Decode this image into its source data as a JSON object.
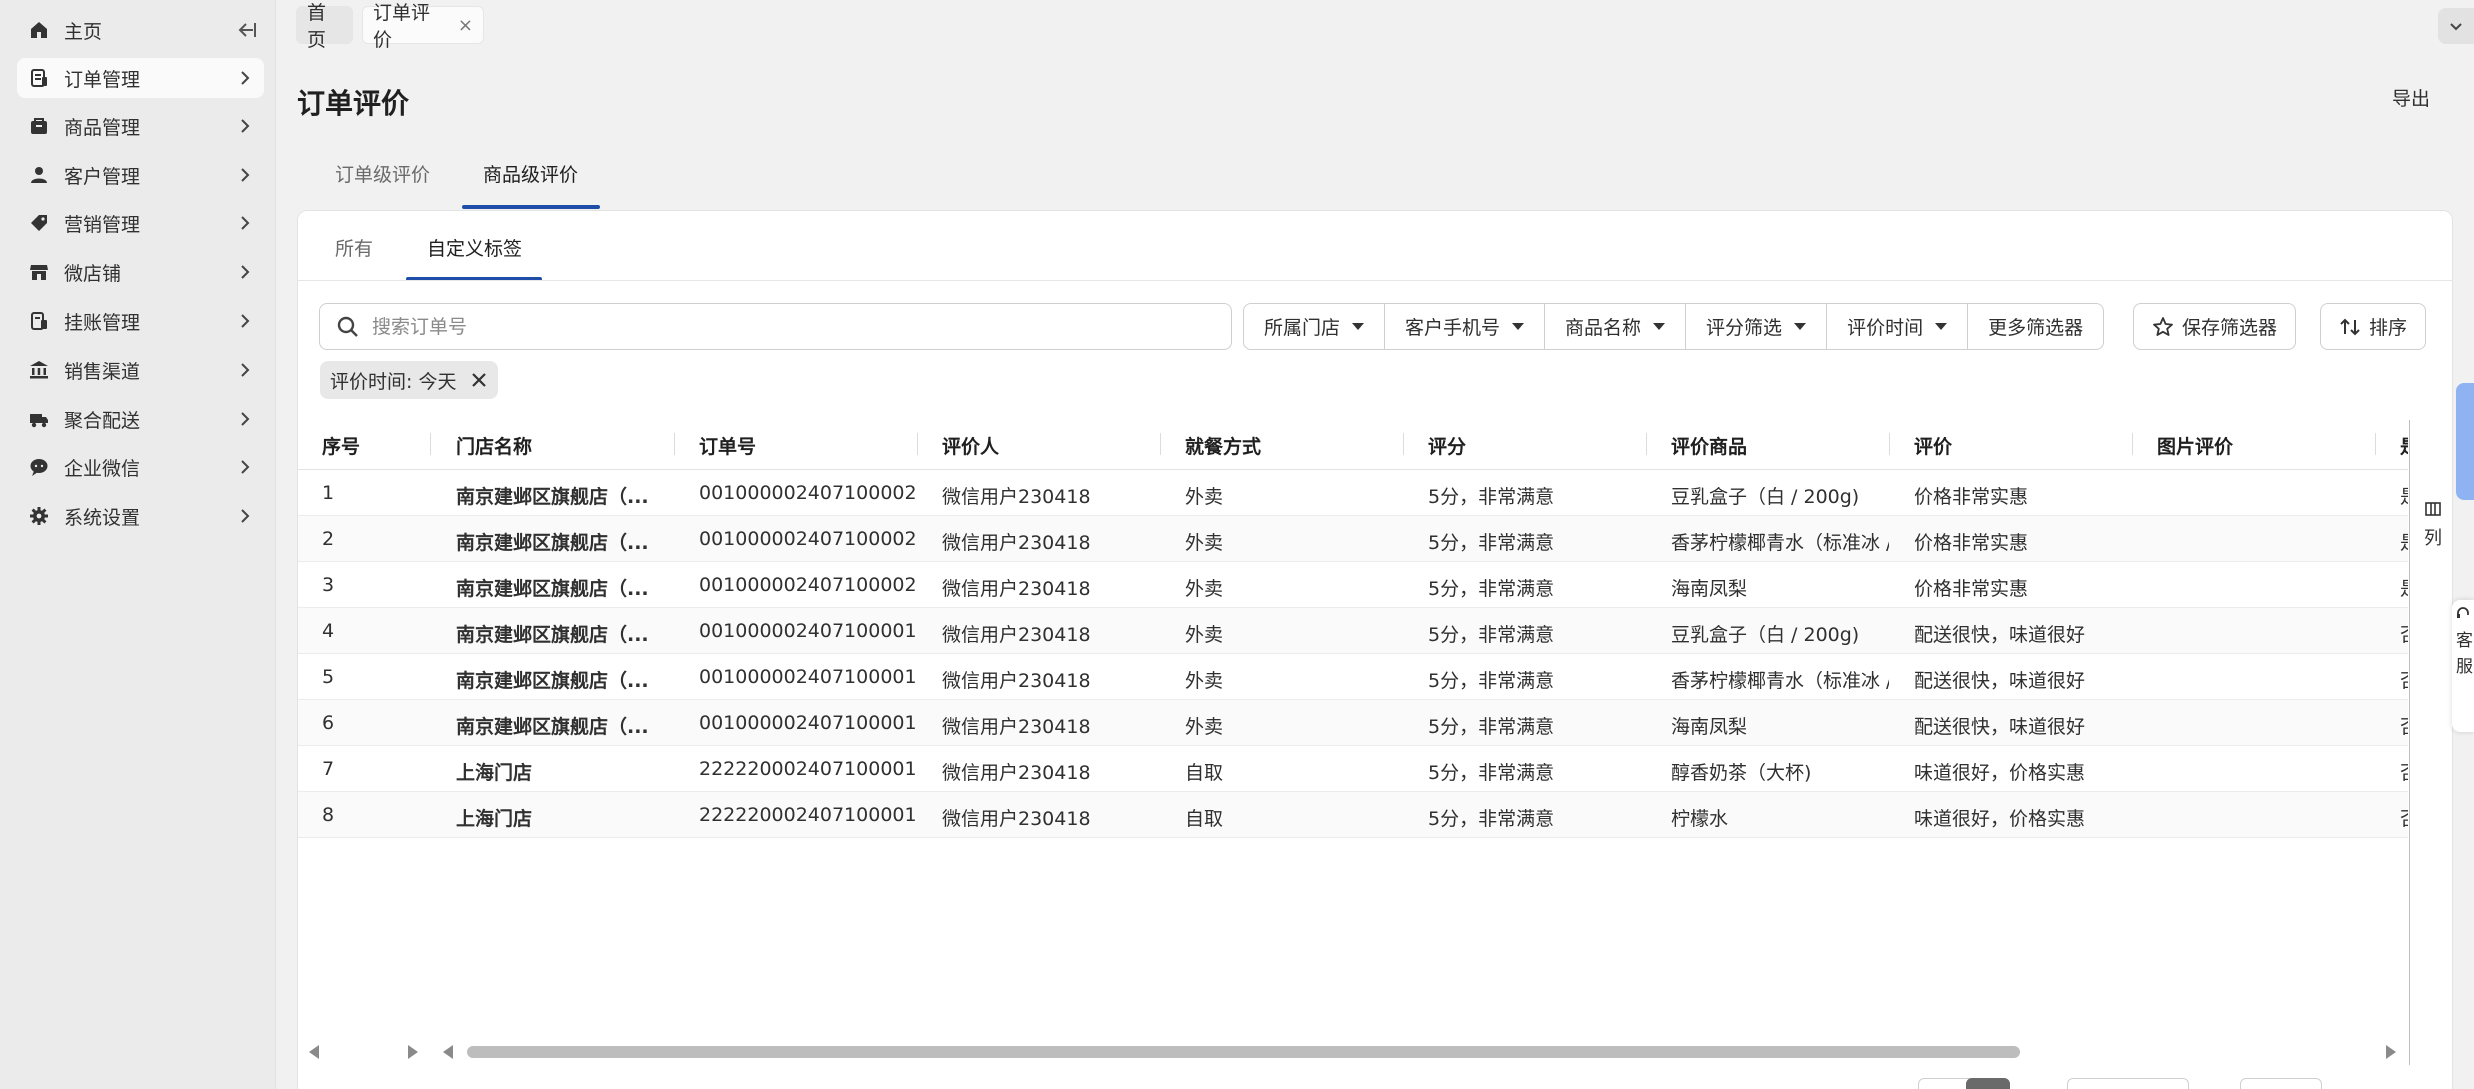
{
  "sidebar": {
    "items": [
      {
        "label": "主页",
        "icon": "home-icon"
      },
      {
        "label": "订单管理",
        "icon": "order-icon"
      },
      {
        "label": "商品管理",
        "icon": "product-icon"
      },
      {
        "label": "客户管理",
        "icon": "person-icon"
      },
      {
        "label": "营销管理",
        "icon": "tag-icon"
      },
      {
        "label": "微店铺",
        "icon": "store-icon"
      },
      {
        "label": "挂账管理",
        "icon": "ledger-icon"
      },
      {
        "label": "销售渠道",
        "icon": "bank-icon"
      },
      {
        "label": "聚合配送",
        "icon": "delivery-icon"
      },
      {
        "label": "企业微信",
        "icon": "wechat-icon"
      },
      {
        "label": "系统设置",
        "icon": "gear-icon"
      }
    ],
    "active_index": 1
  },
  "top_tabs": {
    "home": "首页",
    "current": "订单评价",
    "close_glyph": "×"
  },
  "page": {
    "title": "订单评价",
    "export": "导出"
  },
  "level_tabs": [
    {
      "label": "订单级评价",
      "active": false
    },
    {
      "label": "商品级评价",
      "active": true
    }
  ],
  "sub_tabs": [
    {
      "label": "所有",
      "active": false
    },
    {
      "label": "自定义标签",
      "active": true
    }
  ],
  "filters": {
    "search_placeholder": "搜索订单号",
    "dropdowns": [
      "所属门店",
      "客户手机号",
      "商品名称",
      "评分筛选",
      "评价时间"
    ],
    "more": "更多筛选器",
    "save": "保存筛选器",
    "sort": "排序"
  },
  "chip": {
    "label": "评价时间: 今天"
  },
  "table": {
    "columns": [
      "序号",
      "门店名称",
      "订单号",
      "评价人",
      "就餐方式",
      "评分",
      "评价商品",
      "评价",
      "图片评价",
      "是"
    ],
    "rows": [
      {
        "no": "1",
        "store": "南京建邺区旗舰店（...",
        "order": "001000002407100002",
        "reviewer": "微信用户230418",
        "mode": "外卖",
        "score": "5分，非常满意",
        "item": "豆乳盒子（白 / 200g)",
        "comment": "价格非常实惠",
        "photo": "",
        "extra": "是"
      },
      {
        "no": "2",
        "store": "南京建邺区旗舰店（...",
        "order": "001000002407100002",
        "reviewer": "微信用户230418",
        "mode": "外卖",
        "score": "5分，非常满意",
        "item": "香茅柠檬椰青水（标准冰 /",
        "comment": "价格非常实惠",
        "photo": "",
        "extra": "是"
      },
      {
        "no": "3",
        "store": "南京建邺区旗舰店（...",
        "order": "001000002407100002",
        "reviewer": "微信用户230418",
        "mode": "外卖",
        "score": "5分，非常满意",
        "item": "海南凤梨",
        "comment": "价格非常实惠",
        "photo": "",
        "extra": "是"
      },
      {
        "no": "4",
        "store": "南京建邺区旗舰店（...",
        "order": "001000002407100001",
        "reviewer": "微信用户230418",
        "mode": "外卖",
        "score": "5分，非常满意",
        "item": "豆乳盒子（白 / 200g)",
        "comment": "配送很快，味道很好",
        "photo": "",
        "extra": "否"
      },
      {
        "no": "5",
        "store": "南京建邺区旗舰店（...",
        "order": "001000002407100001",
        "reviewer": "微信用户230418",
        "mode": "外卖",
        "score": "5分，非常满意",
        "item": "香茅柠檬椰青水（标准冰 /",
        "comment": "配送很快，味道很好",
        "photo": "",
        "extra": "否"
      },
      {
        "no": "6",
        "store": "南京建邺区旗舰店（...",
        "order": "001000002407100001",
        "reviewer": "微信用户230418",
        "mode": "外卖",
        "score": "5分，非常满意",
        "item": "海南凤梨",
        "comment": "配送很快，味道很好",
        "photo": "",
        "extra": "否"
      },
      {
        "no": "7",
        "store": "上海门店",
        "order": "222220002407100001",
        "reviewer": "微信用户230418",
        "mode": "自取",
        "score": "5分，非常满意",
        "item": "醇香奶茶（大杯)",
        "comment": "味道很好，价格实惠",
        "photo": "",
        "extra": "否"
      },
      {
        "no": "8",
        "store": "上海门店",
        "order": "222220002407100001",
        "reviewer": "微信用户230418",
        "mode": "自取",
        "score": "5分，非常满意",
        "item": "柠檬水",
        "comment": "味道很好，价格实惠",
        "photo": "",
        "extra": "否"
      }
    ]
  },
  "side_tools": {
    "columns": "列",
    "service": "客服"
  },
  "colors": {
    "accent": "#1f4ea8",
    "side_tab": "#8fb2f2"
  }
}
